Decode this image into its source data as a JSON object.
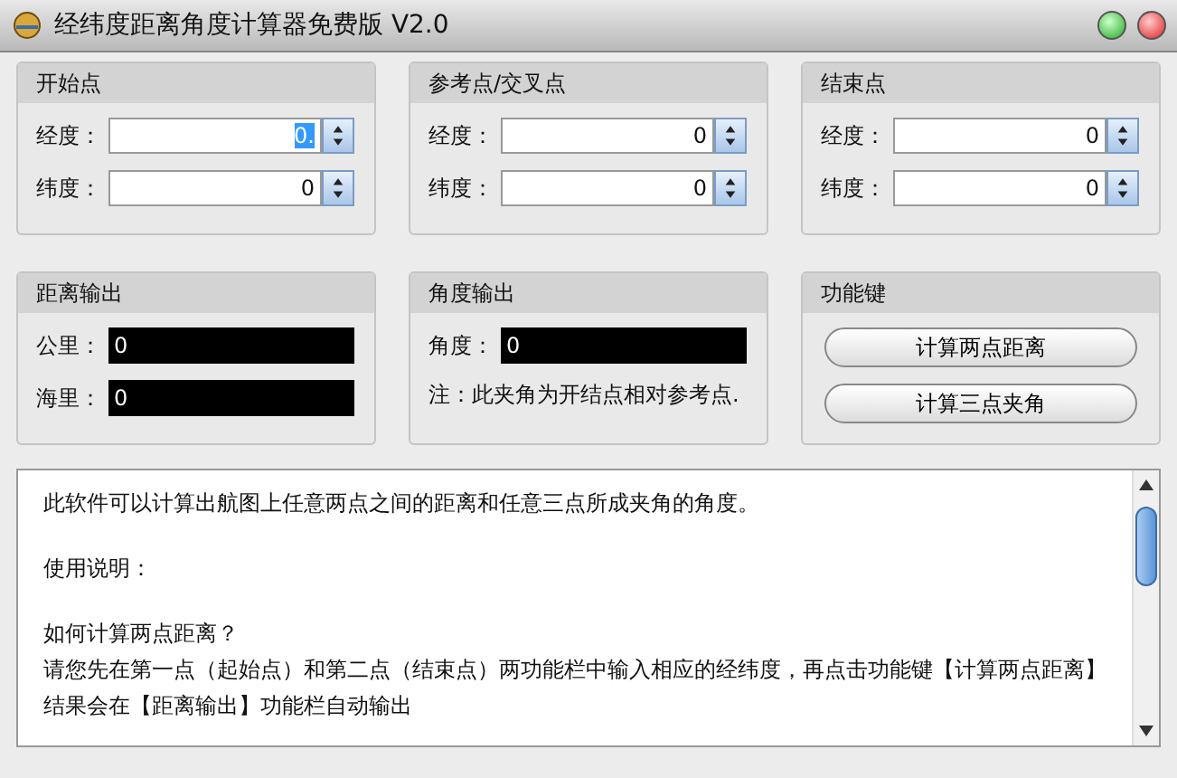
{
  "window": {
    "title": "经纬度距离角度计算器免费版 V2.0"
  },
  "points": [
    {
      "title": "开始点",
      "fields": [
        {
          "label": "经度：",
          "value": "0.",
          "text_selected": true
        },
        {
          "label": "纬度：",
          "value": "0",
          "text_selected": false
        }
      ]
    },
    {
      "title": "参考点/交叉点",
      "fields": [
        {
          "label": "经度：",
          "value": "0",
          "text_selected": false
        },
        {
          "label": "纬度：",
          "value": "0",
          "text_selected": false
        }
      ]
    },
    {
      "title": "结束点",
      "fields": [
        {
          "label": "经度：",
          "value": "0",
          "text_selected": false
        },
        {
          "label": "纬度：",
          "value": "0",
          "text_selected": false
        }
      ]
    }
  ],
  "distance_output": {
    "title": "距离输出",
    "rows": [
      {
        "label": "公里：",
        "value": "0"
      },
      {
        "label": "海里：",
        "value": "0"
      }
    ]
  },
  "angle_output": {
    "title": "角度输出",
    "rows": [
      {
        "label": "角度：",
        "value": "0"
      }
    ],
    "note": "注：此夹角为开结点相对参考点."
  },
  "function_keys": {
    "title": "功能键",
    "buttons": [
      "计算两点距离",
      "计算三点夹角"
    ]
  },
  "instructions": [
    [
      "此软件可以计算出航图上任意两点之间的距离和任意三点所成夹角的角度。"
    ],
    [
      "使用说明："
    ],
    [
      "如何计算两点距离？",
      "请您先在第一点（起始点）和第二点（结束点）两功能栏中输入相应的经纬度，再点击功能键【计算两点距离】",
      "结果会在【距离输出】功能栏自动输出"
    ]
  ]
}
